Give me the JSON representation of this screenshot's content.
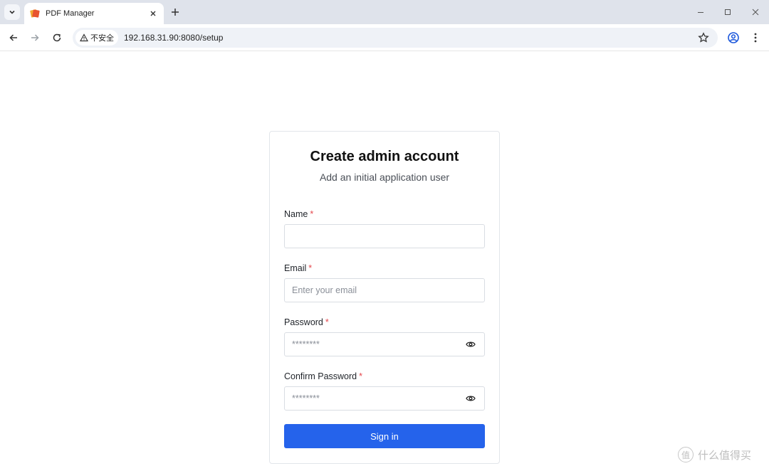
{
  "browser": {
    "tab": {
      "title": "PDF Manager"
    },
    "omnibox": {
      "security_label": "不安全",
      "url": "192.168.31.90:8080/setup"
    }
  },
  "setup": {
    "title": "Create admin account",
    "subtitle": "Add an initial application user",
    "required_marker": "*",
    "fields": {
      "name": {
        "label": "Name",
        "value": "",
        "placeholder": ""
      },
      "email": {
        "label": "Email",
        "value": "",
        "placeholder": "Enter your email"
      },
      "password": {
        "label": "Password",
        "value": "",
        "placeholder": "********"
      },
      "confirm_password": {
        "label": "Confirm Password",
        "value": "",
        "placeholder": "********"
      }
    },
    "submit_label": "Sign in"
  },
  "watermark": {
    "badge": "值",
    "text": "什么值得买"
  },
  "colors": {
    "accent": "#2563eb",
    "required": "#e5484d",
    "tabbar": "#dfe3eb"
  }
}
